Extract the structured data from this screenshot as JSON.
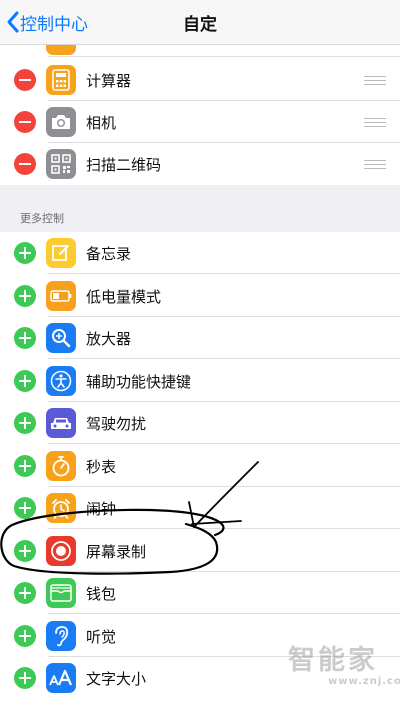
{
  "navbar": {
    "back_label": "控制中心",
    "title": "自定"
  },
  "included": [
    {
      "label": "计算器",
      "icon": "calculator-icon",
      "color": "#f6a21a"
    },
    {
      "label": "相机",
      "icon": "camera-icon",
      "color": "#8e8e93"
    },
    {
      "label": "扫描二维码",
      "icon": "qr-code-icon",
      "color": "#8e8e93"
    }
  ],
  "more_controls": {
    "header": "更多控制",
    "items": [
      {
        "label": "备忘录",
        "icon": "notes-icon",
        "color": "#fecb2f"
      },
      {
        "label": "低电量模式",
        "icon": "battery-icon",
        "color": "#f7a01c"
      },
      {
        "label": "放大器",
        "icon": "magnifier-icon",
        "color": "#1a7cf5"
      },
      {
        "label": "辅助功能快捷键",
        "icon": "accessibility-icon",
        "color": "#1a7cf5"
      },
      {
        "label": "驾驶勿扰",
        "icon": "car-icon",
        "color": "#5b5ad6"
      },
      {
        "label": "秒表",
        "icon": "stopwatch-icon",
        "color": "#f6a21a"
      },
      {
        "label": "闹钟",
        "icon": "alarm-icon",
        "color": "#f6a21a"
      },
      {
        "label": "屏幕录制",
        "icon": "screen-record-icon",
        "color": "#e8392c"
      },
      {
        "label": "钱包",
        "icon": "wallet-icon",
        "color": "#3fc956"
      },
      {
        "label": "听觉",
        "icon": "ear-icon",
        "color": "#1a7cf5"
      },
      {
        "label": "文字大小",
        "icon": "text-size-icon",
        "color": "#1a7cf5"
      }
    ]
  },
  "watermark": {
    "main": "智能家",
    "url": "www.znj.com"
  }
}
